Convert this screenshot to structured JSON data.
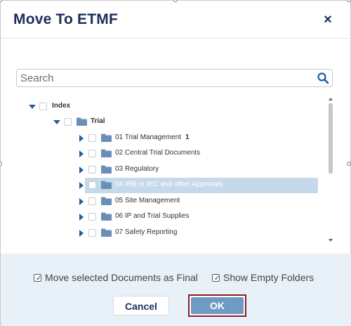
{
  "dialog": {
    "title": "Move To ETMF",
    "close_icon": "×"
  },
  "search": {
    "placeholder": "Search",
    "value": "",
    "icon": "search-icon"
  },
  "tree": {
    "root": {
      "label": "Index",
      "expanded": true,
      "checked": false
    },
    "trial": {
      "label": "Trial",
      "expanded": true,
      "checked": false
    },
    "folders": [
      {
        "label": "01 Trial Management",
        "count": "1",
        "selected": false
      },
      {
        "label": "02 Central Trial Documents",
        "count": "",
        "selected": false
      },
      {
        "label": "03 Regulatory",
        "count": "",
        "selected": false
      },
      {
        "label": "04 IRB or IEC and other Approvals",
        "count": "",
        "selected": true
      },
      {
        "label": "05 Site Management",
        "count": "",
        "selected": false
      },
      {
        "label": "06 IP and Trial Supplies",
        "count": "",
        "selected": false
      },
      {
        "label": "07 Safety Reporting",
        "count": "",
        "selected": false
      }
    ]
  },
  "options": {
    "move_as_final": {
      "label": "Move selected Documents as Final",
      "checked": true
    },
    "show_empty": {
      "label": "Show Empty Folders",
      "checked": true
    }
  },
  "buttons": {
    "cancel": "Cancel",
    "ok": "OK"
  },
  "colors": {
    "title": "#1d2e5c",
    "accent": "#1a5fa8",
    "folder": "#6a8fb6",
    "selected_row": "#c5d9ea",
    "footer_bg": "#e9f1f8",
    "ok_bg": "#6f9ac2",
    "ok_border": "#8b1c2c"
  }
}
